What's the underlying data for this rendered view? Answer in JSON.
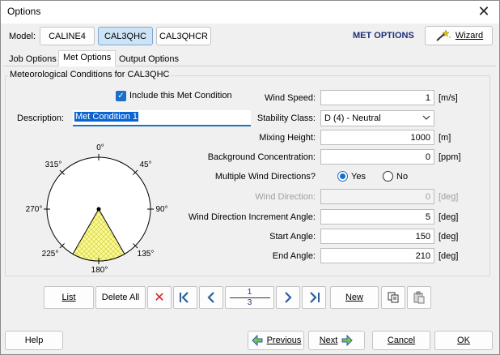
{
  "window": {
    "title": "Options"
  },
  "model": {
    "label": "Model:",
    "buttons": [
      "CALINE4",
      "CAL3QHC",
      "CAL3QHCR"
    ],
    "selected": "CAL3QHC"
  },
  "header": {
    "met_options": "MET OPTIONS",
    "wizard": "Wizard"
  },
  "tabs": [
    "Job Options",
    "Met Options",
    "Output Options"
  ],
  "group": {
    "title": "Meteorological Conditions for CAL3QHC"
  },
  "include": {
    "label": "Include this Met Condition",
    "checked": true
  },
  "description": {
    "label": "Description:",
    "value": "Met Condition 1"
  },
  "fields": {
    "wind_speed": {
      "label": "Wind Speed:",
      "value": "1",
      "unit": "[m/s]"
    },
    "stability_class": {
      "label": "Stability Class:",
      "value": "D (4) - Neutral"
    },
    "mixing_height": {
      "label": "Mixing Height:",
      "value": "1000",
      "unit": "[m]"
    },
    "background_conc": {
      "label": "Background Concentration:",
      "value": "0",
      "unit": "[ppm]"
    },
    "multiple_wind": {
      "label": "Multiple Wind Directions?",
      "yes": "Yes",
      "no": "No",
      "selected": "Yes"
    },
    "wind_direction": {
      "label": "Wind Direction:",
      "value": "0",
      "unit": "[deg]"
    },
    "increment_angle": {
      "label": "Wind Direction Increment Angle:",
      "value": "5",
      "unit": "[deg]"
    },
    "start_angle": {
      "label": "Start Angle:",
      "value": "150",
      "unit": "[deg]"
    },
    "end_angle": {
      "label": "End Angle:",
      "value": "210",
      "unit": "[deg]"
    }
  },
  "compass": {
    "labels": [
      "0°",
      "45°",
      "90°",
      "135°",
      "180°",
      "225°",
      "270°",
      "315°"
    ],
    "start_angle": 150,
    "end_angle": 210
  },
  "records": {
    "list": "List",
    "delete_all": "Delete All",
    "current": "1",
    "total": "3",
    "new": "New"
  },
  "footer": {
    "help": "Help",
    "previous": "Previous",
    "next": "Next",
    "cancel": "Cancel",
    "ok": "OK"
  }
}
